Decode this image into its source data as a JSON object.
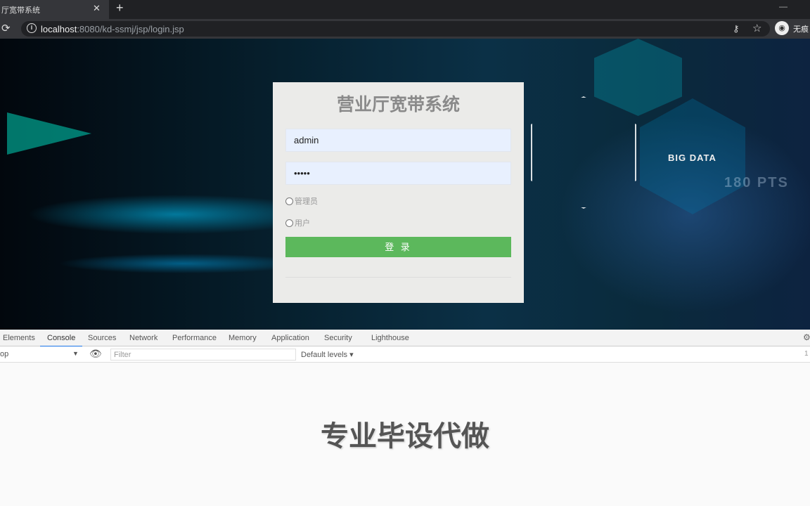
{
  "browser": {
    "tab_title": "厅宽带系统",
    "url_host": "localhost",
    "url_path": ":8080/kd-ssmj/jsp/login.jsp",
    "profile_label": "无痕"
  },
  "login": {
    "title": "营业厅宽带系统",
    "username": "admin",
    "password": "•••••",
    "roles": [
      "管理员",
      "用户"
    ],
    "submit": "登 录"
  },
  "background": {
    "big_data": "BIG DATA",
    "pts": "180 PTS"
  },
  "devtools": {
    "tabs": [
      "Elements",
      "Console",
      "Sources",
      "Network",
      "Performance",
      "Memory",
      "Application",
      "Security",
      "Lighthouse"
    ],
    "active_tab": "Console",
    "context": "op",
    "filter_placeholder": "Filter",
    "levels": "Default levels ▾",
    "side": "1"
  },
  "watermark": "专业毕设代做",
  "colors": {
    "button": "#5cb85c",
    "active_tab": "#1a73e8"
  }
}
